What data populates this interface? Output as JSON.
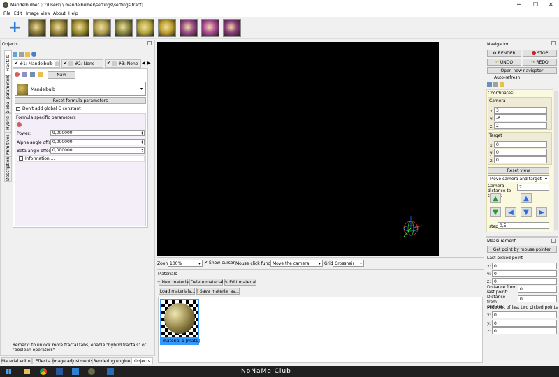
{
  "window": {
    "title": "Mandelbulber (C:\\Users\\       \\.mandelbulber\\settings\\settings.fract)"
  },
  "menu": [
    "File",
    "Edit",
    "Image",
    "View",
    "About",
    "Help"
  ],
  "toolbar": {
    "thumb_colors": [
      "#8a7a3a",
      "#9a8a40",
      "#a09030",
      "#b0a050",
      "#8d8a45",
      "#b8a840",
      "#c0a030",
      "#9a4a8a",
      "#b04a9a",
      "#8a3a7a"
    ]
  },
  "objects": {
    "title": "Objects",
    "tabs": [
      "#1: Mandelbulb",
      "#2: None",
      "#3: None"
    ],
    "navi_label": "Navi",
    "formula_name": "Mandelbulb",
    "reset_formula": "Reset formula parameters",
    "dont_add_c": "Don't add global C constant",
    "formula_specific": "Formula specific parameters",
    "params": [
      {
        "label": "Power:",
        "value": "9,000000"
      },
      {
        "label": "Alpha angle offset:",
        "value": "0,000000"
      },
      {
        "label": "Beta angle offset:",
        "value": "0,000000"
      }
    ],
    "information": "Information ...",
    "remark": "Remark: to unlock more fractal tabs, enable \"hybrid fractals\" or \"boolean operators\"",
    "vertical_tabs": [
      "Fractals",
      "Global parameters",
      "Hybrid",
      "Primitives",
      "Description"
    ]
  },
  "bottom_tabs": [
    "Material editor",
    "Effects",
    "Image adjustments",
    "Rendering engine",
    "Objects"
  ],
  "render_controls": {
    "zoom_label": "Zoom:",
    "zoom_value": "100%",
    "show_cursor": "Show cursor",
    "mouse_click_label": "Mouse click function:",
    "mouse_click_value": "Move the camera",
    "grid_label": "Grid:",
    "grid_value": "Crosshair"
  },
  "materials": {
    "title": "Materials",
    "new": "New material",
    "delete": "Delete material",
    "edit": "Edit material",
    "load": "Load materials...",
    "save": "Save material as...",
    "item_label": "material 1 [mat1]"
  },
  "navigation": {
    "title": "Navigation",
    "render": "RENDER",
    "stop": "STOP",
    "undo": "UNDO",
    "redo": "REDO",
    "open_new": "Open new navigator",
    "auto_refresh": "Auto-refresh",
    "coordinates": "Coordinates:",
    "camera": "Camera",
    "camera_xyz": [
      {
        "axis": "x:",
        "value": "3"
      },
      {
        "axis": "y:",
        "value": "-6"
      },
      {
        "axis": "z:",
        "value": "2"
      }
    ],
    "target": "Target",
    "target_xyz": [
      {
        "axis": "x:",
        "value": "0"
      },
      {
        "axis": "y:",
        "value": "0"
      },
      {
        "axis": "z:",
        "value": "0"
      }
    ],
    "reset_view": "Reset view",
    "move_mode": "Move camera and target",
    "cam_dist_label": "Camera distance to target:",
    "cam_dist_value": "7",
    "step_label": "step:",
    "step_value": "0,5"
  },
  "measurement": {
    "title": "Measurement",
    "get_point": "Get point by mouse pointer",
    "last_picked": "Last picked point",
    "xyz": [
      {
        "axis": "x:",
        "value": "0"
      },
      {
        "axis": "y:",
        "value": "0"
      },
      {
        "axis": "z:",
        "value": "0"
      }
    ],
    "dist_last": "Distance from last point:",
    "dist_last_value": "0",
    "dist_cam": "Distance from camera:",
    "dist_cam_value": "0",
    "midpoint": "Midpoint of last two picked points",
    "mid_xyz": [
      {
        "axis": "x:",
        "value": "0"
      },
      {
        "axis": "y:",
        "value": "0"
      },
      {
        "axis": "z:",
        "value": "0"
      }
    ]
  },
  "taskbar": {
    "watermark": "NoNaMe Club"
  },
  "colors": {
    "accent": "#2f7fd8",
    "selection": "#3399ff",
    "render_bg": "#000000",
    "nav_panel_bg": "#fbf8e0",
    "formula_panel_bg": "#f3eef8"
  }
}
